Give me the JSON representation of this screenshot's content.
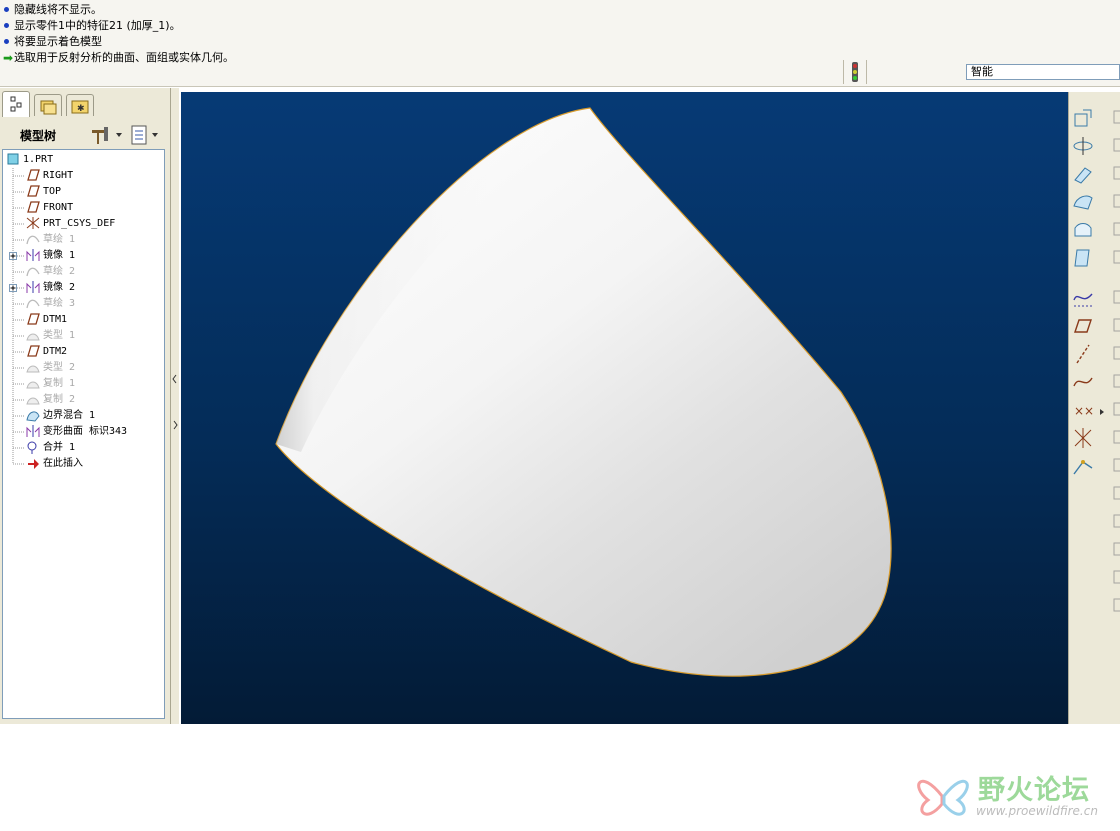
{
  "messages": [
    {
      "kind": "info",
      "text": "隐藏线将不显示。"
    },
    {
      "kind": "info",
      "text": "显示零件1中的特征21 (加厚_1)。"
    },
    {
      "kind": "info",
      "text": "将要显示着色模型"
    },
    {
      "kind": "prompt",
      "text": "选取用于反射分析的曲面、面组或实体几何。"
    }
  ],
  "filter": {
    "value": "智能"
  },
  "model_tree": {
    "title": "模型树",
    "items": [
      {
        "label": "1.PRT",
        "icon": "part-icon",
        "dim": false,
        "expand": false,
        "indent": 0
      },
      {
        "label": "RIGHT",
        "icon": "datum-plane-icon",
        "dim": false,
        "expand": false,
        "indent": 1
      },
      {
        "label": "TOP",
        "icon": "datum-plane-icon",
        "dim": false,
        "expand": false,
        "indent": 1
      },
      {
        "label": "FRONT",
        "icon": "datum-plane-icon",
        "dim": false,
        "expand": false,
        "indent": 1
      },
      {
        "label": "PRT_CSYS_DEF",
        "icon": "csys-icon",
        "dim": false,
        "expand": false,
        "indent": 1
      },
      {
        "label": "草绘 1",
        "icon": "sketch-icon",
        "dim": true,
        "expand": false,
        "indent": 1
      },
      {
        "label": "镜像 1",
        "icon": "mirror-icon",
        "dim": false,
        "expand": true,
        "indent": 1
      },
      {
        "label": "草绘 2",
        "icon": "sketch-icon",
        "dim": true,
        "expand": false,
        "indent": 1
      },
      {
        "label": "镜像 2",
        "icon": "mirror-icon",
        "dim": false,
        "expand": true,
        "indent": 1
      },
      {
        "label": "草绘 3",
        "icon": "sketch-icon",
        "dim": true,
        "expand": false,
        "indent": 1
      },
      {
        "label": "DTM1",
        "icon": "datum-plane-icon",
        "dim": false,
        "expand": false,
        "indent": 1
      },
      {
        "label": "类型 1",
        "icon": "surface-icon",
        "dim": true,
        "expand": false,
        "indent": 1
      },
      {
        "label": "DTM2",
        "icon": "datum-plane-icon",
        "dim": false,
        "expand": false,
        "indent": 1
      },
      {
        "label": "类型 2",
        "icon": "surface-icon",
        "dim": true,
        "expand": false,
        "indent": 1
      },
      {
        "label": "复制 1",
        "icon": "surface-icon",
        "dim": true,
        "expand": false,
        "indent": 1
      },
      {
        "label": "复制 2",
        "icon": "surface-icon",
        "dim": true,
        "expand": false,
        "indent": 1
      },
      {
        "label": "边界混合 1",
        "icon": "boundary-blend-icon",
        "dim": false,
        "expand": false,
        "indent": 1
      },
      {
        "label": "变形曲面 标识343",
        "icon": "mirror-icon",
        "dim": false,
        "expand": false,
        "indent": 1
      },
      {
        "label": "合并 1",
        "icon": "merge-icon",
        "dim": false,
        "expand": false,
        "indent": 1
      },
      {
        "label": "在此插入",
        "icon": "insert-here-icon",
        "dim": false,
        "expand": false,
        "indent": 1
      }
    ]
  },
  "right_toolbar": [
    "datum-plane-tool-icon",
    "revolve-icon",
    "sweep-icon",
    "boundary-blend-tool-icon",
    "fill-icon",
    "thicken-icon",
    "datum-curve-icon",
    "plane-icon",
    "axis-icon",
    "sketched-curve-icon",
    "datum-point-icon",
    "coord-system-icon",
    "analysis-icon"
  ],
  "watermark": {
    "title": "野火论坛",
    "url": "www.proewildfire.cn"
  },
  "colors": {
    "viewport_top": "#063a75",
    "viewport_bottom": "#031b36",
    "accent": "#1a3fbf"
  }
}
